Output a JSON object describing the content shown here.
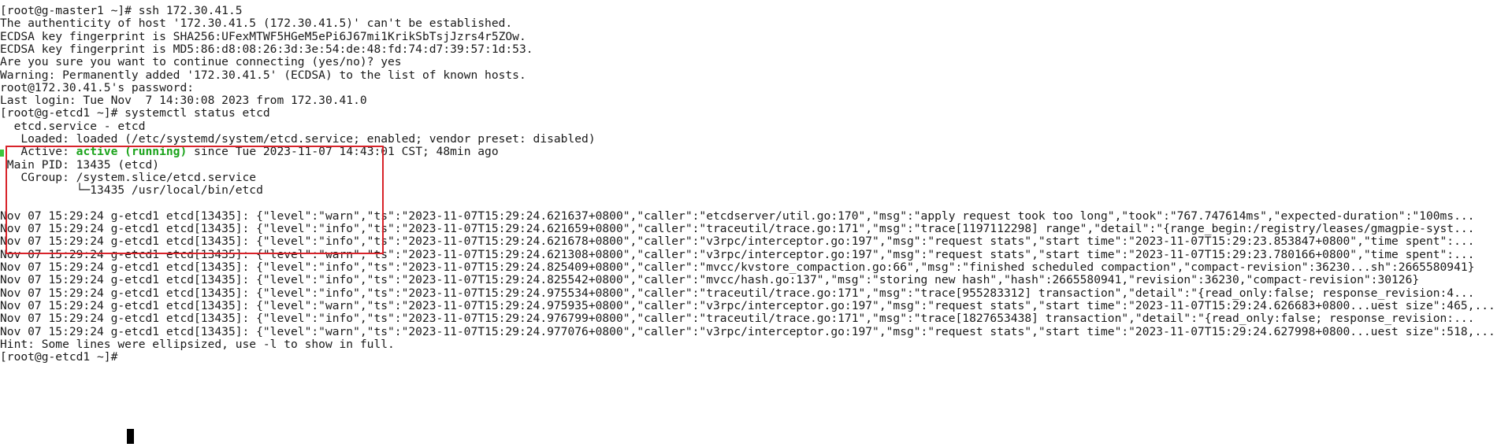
{
  "terminal": {
    "lines": [
      {
        "segments": [
          {
            "text": "[root@g-master1 ~]# ssh 172.30.41.5"
          }
        ]
      },
      {
        "segments": [
          {
            "text": "The authenticity of host '172.30.41.5 (172.30.41.5)' can't be established."
          }
        ]
      },
      {
        "segments": [
          {
            "text": "ECDSA key fingerprint is SHA256:UFexMTWF5HGeM5ePi6J67mi1KrikSbTsjJzrs4r5ZOw."
          }
        ]
      },
      {
        "segments": [
          {
            "text": "ECDSA key fingerprint is MD5:86:d8:08:26:3d:3e:54:de:48:fd:74:d7:39:57:1d:53."
          }
        ]
      },
      {
        "segments": [
          {
            "text": "Are you sure you want to continue connecting (yes/no)? yes"
          }
        ]
      },
      {
        "segments": [
          {
            "text": "Warning: Permanently added '172.30.41.5' (ECDSA) to the list of known hosts."
          }
        ]
      },
      {
        "segments": [
          {
            "text": "root@172.30.41.5's password:"
          }
        ]
      },
      {
        "segments": [
          {
            "text": "Last login: Tue Nov  7 14:30:08 2023 from 172.30.41.0"
          }
        ]
      },
      {
        "segments": [
          {
            "text": "[root@g-etcd1 ~]# systemctl status etcd"
          }
        ]
      },
      {
        "segments": [
          {
            "text": "  etcd.service - etcd"
          }
        ]
      },
      {
        "segments": [
          {
            "text": "   Loaded: loaded (/etc/systemd/system/etcd.service; enabled; vendor preset: disabled)"
          }
        ]
      },
      {
        "segments": [
          {
            "text": "   Active: "
          },
          {
            "text": "active (running)",
            "style": "green"
          },
          {
            "text": " since Tue 2023-11-07 14:43:01 CST; 48min ago"
          }
        ]
      },
      {
        "segments": [
          {
            "text": " Main PID: 13435 (etcd)"
          }
        ]
      },
      {
        "segments": [
          {
            "text": "   CGroup: /system.slice/etcd.service"
          }
        ]
      },
      {
        "segments": [
          {
            "text": "           └─13435 /usr/local/bin/etcd"
          }
        ]
      },
      {
        "segments": [
          {
            "text": ""
          }
        ]
      },
      {
        "segments": [
          {
            "text": "Nov 07 15:29:24 g-etcd1 etcd[13435]: {\"level\":\"warn\",\"ts\":\"2023-11-07T15:29:24.621637+0800\",\"caller\":\"etcdserver/util.go:170\",\"msg\":\"apply request took too long\",\"took\":\"767.747614ms\",\"expected-duration\":\"100ms..."
          }
        ]
      },
      {
        "segments": [
          {
            "text": "Nov 07 15:29:24 g-etcd1 etcd[13435]: {\"level\":\"info\",\"ts\":\"2023-11-07T15:29:24.621659+0800\",\"caller\":\"traceutil/trace.go:171\",\"msg\":\"trace[1197112298] range\",\"detail\":\"{range_begin:/registry/leases/gmagpie-syst..."
          }
        ]
      },
      {
        "segments": [
          {
            "text": "Nov 07 15:29:24 g-etcd1 etcd[13435]: {\"level\":\"info\",\"ts\":\"2023-11-07T15:29:24.621678+0800\",\"caller\":\"v3rpc/interceptor.go:197\",\"msg\":\"request stats\",\"start time\":\"2023-11-07T15:29:23.853847+0800\",\"time spent\":..."
          }
        ]
      },
      {
        "segments": [
          {
            "text": "Nov 07 15:29:24 g-etcd1 etcd[13435]: {\"level\":\"warn\",\"ts\":\"2023-11-07T15:29:24.621308+0800\",\"caller\":\"v3rpc/interceptor.go:197\",\"msg\":\"request stats\",\"start time\":\"2023-11-07T15:29:23.780166+0800\",\"time spent\":..."
          }
        ]
      },
      {
        "segments": [
          {
            "text": "Nov 07 15:29:24 g-etcd1 etcd[13435]: {\"level\":\"info\",\"ts\":\"2023-11-07T15:29:24.825409+0800\",\"caller\":\"mvcc/kvstore_compaction.go:66\",\"msg\":\"finished scheduled compaction\",\"compact-revision\":36230...sh\":2665580941}"
          }
        ]
      },
      {
        "segments": [
          {
            "text": "Nov 07 15:29:24 g-etcd1 etcd[13435]: {\"level\":\"info\",\"ts\":\"2023-11-07T15:29:24.825542+0800\",\"caller\":\"mvcc/hash.go:137\",\"msg\":\"storing new hash\",\"hash\":2665580941,\"revision\":36230,\"compact-revision\":30126}"
          }
        ]
      },
      {
        "segments": [
          {
            "text": "Nov 07 15:29:24 g-etcd1 etcd[13435]: {\"level\":\"info\",\"ts\":\"2023-11-07T15:29:24.975534+0800\",\"caller\":\"traceutil/trace.go:171\",\"msg\":\"trace[955283312] transaction\",\"detail\":\"{read_only:false; response_revision:4..."
          }
        ]
      },
      {
        "segments": [
          {
            "text": "Nov 07 15:29:24 g-etcd1 etcd[13435]: {\"level\":\"warn\",\"ts\":\"2023-11-07T15:29:24.975935+0800\",\"caller\":\"v3rpc/interceptor.go:197\",\"msg\":\"request stats\",\"start time\":\"2023-11-07T15:29:24.626683+0800...uest size\":465,..."
          }
        ]
      },
      {
        "segments": [
          {
            "text": "Nov 07 15:29:24 g-etcd1 etcd[13435]: {\"level\":\"info\",\"ts\":\"2023-11-07T15:29:24.976799+0800\",\"caller\":\"traceutil/trace.go:171\",\"msg\":\"trace[1827653438] transaction\",\"detail\":\"{read_only:false; response_revision:..."
          }
        ]
      },
      {
        "segments": [
          {
            "text": "Nov 07 15:29:24 g-etcd1 etcd[13435]: {\"level\":\"warn\",\"ts\":\"2023-11-07T15:29:24.977076+0800\",\"caller\":\"v3rpc/interceptor.go:197\",\"msg\":\"request stats\",\"start time\":\"2023-11-07T15:29:24.627998+0800...uest size\":518,..."
          }
        ]
      },
      {
        "segments": [
          {
            "text": "Hint: Some lines were ellipsized, use -l to show in full."
          }
        ]
      },
      {
        "segments": [
          {
            "text": "[root@g-etcd1 ~]# "
          }
        ]
      }
    ]
  },
  "colors": {
    "background": "#ffffff",
    "text": "#1a1a1a",
    "active_green": "#1aa31a",
    "status_dot": "#3cc63c",
    "highlight_border": "#d8232a",
    "cursor": "#000000"
  }
}
